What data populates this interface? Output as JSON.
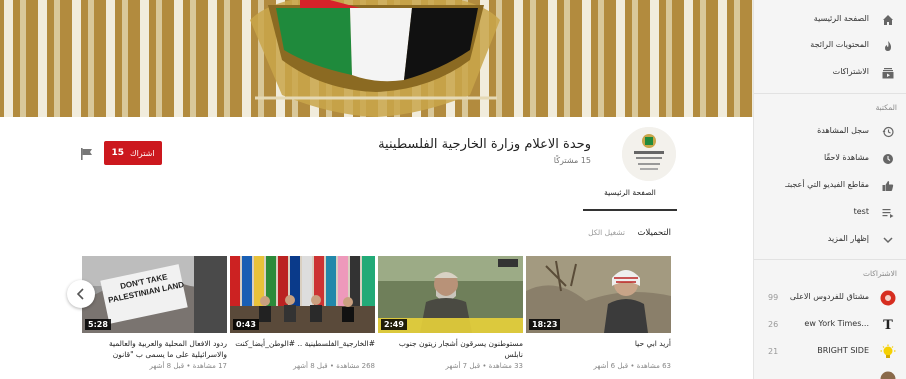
{
  "sidebar": {
    "top_items": [
      {
        "label": "الصفحة الرئيسية",
        "icon": "home-icon"
      },
      {
        "label": "المحتويات الرائجة",
        "icon": "flame-icon"
      },
      {
        "label": "الاشتراكات",
        "icon": "subscriptions-icon"
      }
    ],
    "library_heading": "المكتبة",
    "library_items": [
      {
        "label": "سجل المشاهدة",
        "icon": "history-icon"
      },
      {
        "label": "مشاهدة لاحقًا",
        "icon": "clock-icon"
      },
      {
        "label": "مقاطع الفيديو التي أعجبتـ",
        "icon": "thumbs-up-icon"
      },
      {
        "label": "test",
        "icon": "playlist-icon"
      },
      {
        "label": "إظهار المزيد",
        "icon": "chevron-down-icon"
      }
    ],
    "subs_heading": "الاشتراكات",
    "subscriptions": [
      {
        "name": "مشتاق للفردوس الاعلى",
        "count": "99",
        "color": "#d62d20"
      },
      {
        "name": "ew York Times...",
        "count": "26",
        "color": "#222222"
      },
      {
        "name": "BRIGHT SIDE",
        "count": "21",
        "color": "#f5d000"
      }
    ]
  },
  "channel": {
    "title": "وحدة الاعلام وزارة الخارجية الفلسطينية",
    "subscribers": "15 مشتركًا",
    "subscribe_label": "اشتراك",
    "subscribe_count": "15",
    "avatar_text": "وزارة الخارجية",
    "tab_home": "الصفحة الرئيسية",
    "uploads_heading": "التحميلات",
    "play_all": "تشغيل الكل"
  },
  "videos": [
    {
      "duration": "18:23",
      "title": "أريد ابي حيا",
      "meta": "63 مشاهدة • قبل 6 أشهر"
    },
    {
      "duration": "2:49",
      "title": "مستوطنون يسرقون أشجار زيتون جنوب نابلس",
      "meta": "33 مشاهدة • قبل 7 أشهر"
    },
    {
      "duration": "0:43",
      "title": "#الخارجية_الفلسطينية .. #الوطن_أيضا_كنت",
      "meta": "268 مشاهدة • قبل 8 أشهر"
    },
    {
      "duration": "5:28",
      "title": "ردود الافعال المحلية والعربية والعالمية والاسرائيلية على ما يسمى ب \"قانون",
      "meta": "17 مشاهدة • قبل 8 أشهر"
    }
  ],
  "thumb_text": "DON'T TAKE PALESTINIAN LAND",
  "colors": {
    "accent": "#cc181e",
    "sidebar_bg": "#f5f5f5"
  }
}
